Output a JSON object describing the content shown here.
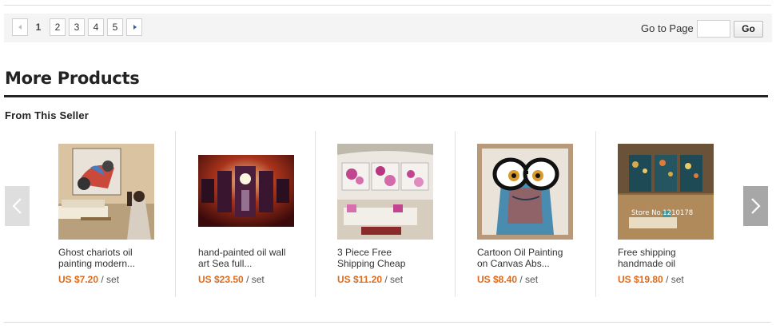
{
  "pagination": {
    "pages": [
      "1",
      "2",
      "3",
      "4",
      "5"
    ],
    "current_page": "1",
    "goto_label": "Go to Page",
    "goto_value": "",
    "go_button": "Go"
  },
  "section": {
    "title": "More Products",
    "subtitle": "From This Seller"
  },
  "products": [
    {
      "title_line1": "Ghost chariots oil",
      "title_line2": "painting modern...",
      "price": "US $7.20",
      "unit": "/ set",
      "image": "motorcycle-painting-in-living-room"
    },
    {
      "title_line1": "hand-painted oil wall",
      "title_line2": "art Sea full...",
      "price": "US $23.50",
      "unit": "/ set",
      "image": "five-panel-moon-sea-painting"
    },
    {
      "title_line1": "3 Piece Free",
      "title_line2": "Shipping Cheap",
      "price": "US $11.20",
      "unit": "/ set",
      "image": "three-panel-magnolia-in-living-room"
    },
    {
      "title_line1": "Cartoon Oil Painting",
      "title_line2": "on Canvas Abs...",
      "price": "US $8.40",
      "unit": "/ set",
      "image": "frog-with-glasses-painting"
    },
    {
      "title_line1": "Free shipping",
      "title_line2": "handmade oil",
      "price": "US $19.80",
      "unit": "/ set",
      "image": "three-panel-abstract-trees-in-room"
    }
  ],
  "watermark": "Store No.1210178",
  "colors": {
    "price": "#e06a1b",
    "heading_rule": "#222222",
    "pager_bg": "#f4f4f4",
    "next_arrow": "#2a63a8"
  }
}
